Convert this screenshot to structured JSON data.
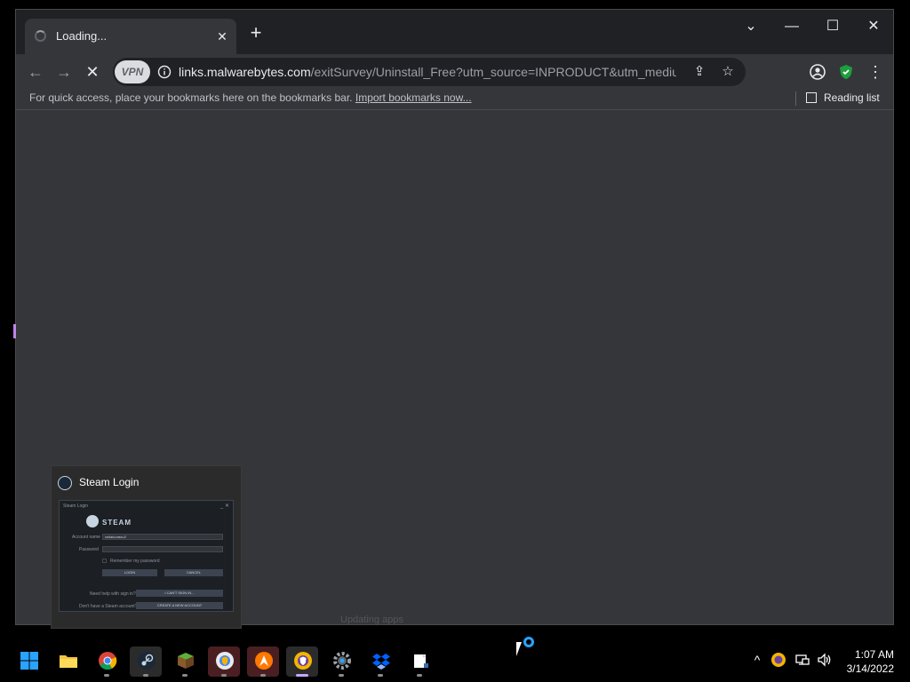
{
  "tab": {
    "title": "Loading...",
    "close": "✕"
  },
  "newtab": "+",
  "window_controls": {
    "dropdown": "⌄",
    "minimize": "—",
    "maximize": "☐",
    "close": "✕"
  },
  "toolbar": {
    "back": "←",
    "forward": "→",
    "stop": "✕",
    "vpn_label": "VPN",
    "url_host": "links.malwarebytes.com",
    "url_path": "/exitSurvey/Uninstall_Free?utm_source=INPRODUCT&utm_medium=Expt&u...",
    "share": "⇪",
    "star": "☆",
    "menu": "⋮"
  },
  "bookmarks": {
    "hint": "For quick access, place your bookmarks here on the bookmarks bar.",
    "import_link": "Import bookmarks now...",
    "reading_list": "Reading list"
  },
  "preview": {
    "title": "Steam Login",
    "thumb": {
      "window_title": "Steam Login",
      "brand": "STEAM",
      "account_label": "Account name",
      "account_value": "cnilaiuoraou2",
      "password_label": "Password",
      "remember": "Remember my password",
      "login_btn": "LOGIN",
      "cancel_btn": "CANCEL",
      "help_label": "Need help with sign in?",
      "help_btn": "I CAN'T SIGN IN...",
      "create_label": "Don't have a Steam account?",
      "create_btn": "CREATE A NEW ACCOUNT"
    },
    "behind_text": "Updating apps"
  },
  "taskbar": {
    "apps": [
      "start",
      "file-explorer",
      "chrome",
      "steam",
      "minecraft",
      "brave-red",
      "avast",
      "brave-purple",
      "settings",
      "dropbox",
      "files"
    ]
  },
  "tray": {
    "chevron": "^",
    "clock_time": "1:07 AM",
    "clock_date": "3/14/2022"
  },
  "colors": {
    "accent": "#29a3ff",
    "steam": "#1b2838",
    "shield": "#1e9e3e"
  }
}
